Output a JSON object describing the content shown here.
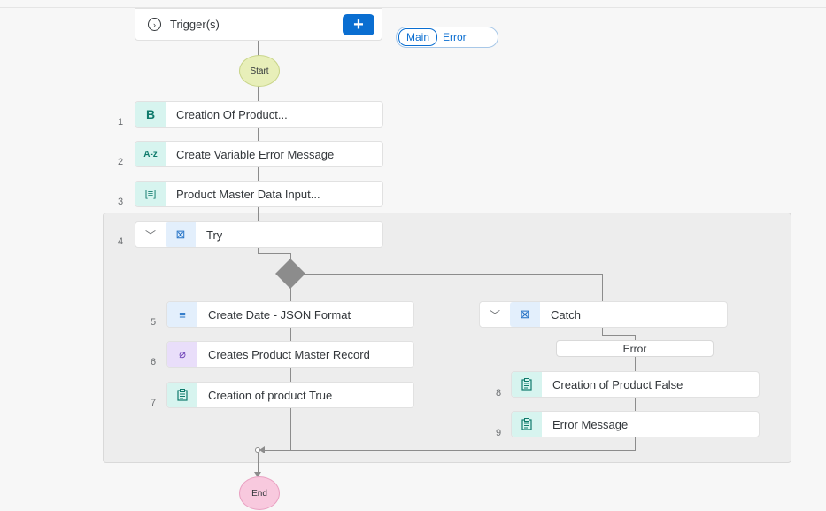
{
  "trigger": {
    "label": "Trigger(s)",
    "add_icon": "plus-icon",
    "expand_icon": "chevron-circle-icon"
  },
  "toggle": {
    "main": "Main",
    "error": "Error"
  },
  "flow": {
    "start": "Start",
    "end": "End"
  },
  "steps": [
    {
      "num": "1",
      "label": "Creation Of Product...",
      "icon": "B"
    },
    {
      "num": "2",
      "label": "Create Variable Error Message",
      "icon": "A-z"
    },
    {
      "num": "3",
      "label": "Product Master Data Input...",
      "icon": "[≡]"
    },
    {
      "num": "4",
      "label": "Try",
      "icon": "⊠"
    },
    {
      "num": "5",
      "label": "Create Date - JSON Format",
      "icon": "≡"
    },
    {
      "num": "6",
      "label": "Creates Product Master Record",
      "icon": "⌀"
    },
    {
      "num": "7",
      "label": "Creation of product True",
      "icon": "📋"
    },
    {
      "num": "8",
      "label": "Creation of Product False",
      "icon": "📋"
    },
    {
      "num": "9",
      "label": "Error Message",
      "icon": "📋"
    }
  ],
  "catch": {
    "label": "Catch",
    "error_badge": "Error",
    "icon": "⊠"
  },
  "colors": {
    "accent": "#0a6ed1",
    "start": "#e8efb9",
    "end": "#f8c9de",
    "group_bg": "#ededed"
  }
}
